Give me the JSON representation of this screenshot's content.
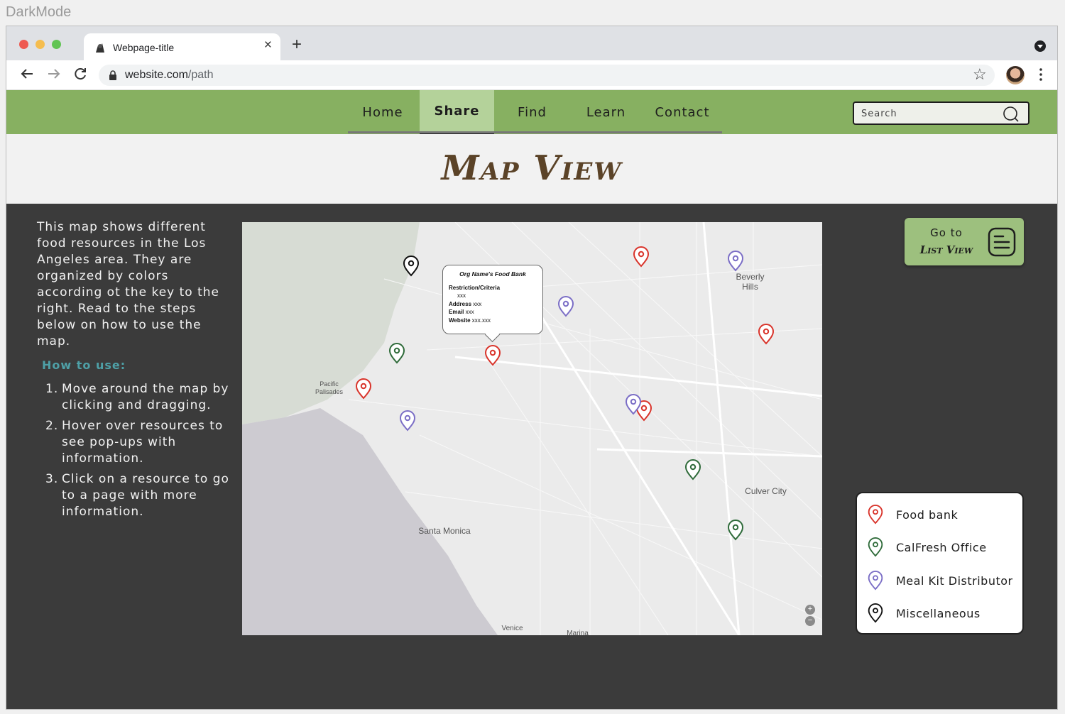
{
  "frame_label": "DarkMode",
  "browser": {
    "tab_title": "Webpage-title",
    "tab_close": "×",
    "new_tab": "+",
    "url_host": "website.com",
    "url_path": "/path",
    "traffic_colors": [
      "#ee5a52",
      "#f5bd4f",
      "#61c454"
    ]
  },
  "nav": {
    "items": [
      {
        "label": "Home"
      },
      {
        "label": "Share",
        "active": true
      },
      {
        "label": "Find"
      },
      {
        "label": "Learn"
      },
      {
        "label": "Contact"
      }
    ],
    "search_placeholder": "Search",
    "bar_color": "#87b061",
    "active_color": "#b4d29a"
  },
  "page_title": "Map View",
  "intro_text": "This map shows different food resources in the Los Angeles area. They are organized by colors according ot the key to the right. Read to the steps below on how to use the map.",
  "howto_title": "How to use:",
  "steps": [
    {
      "num": "1.",
      "text": "Move around the map by clicking and dragging."
    },
    {
      "num": "2.",
      "text": "Hover over resources to see pop-ups with information."
    },
    {
      "num": "3.",
      "text": "Click on a resource to go to a page with more information."
    }
  ],
  "map": {
    "labels": {
      "pacific_palisades": "Pacific\nPalisades",
      "beverly_hills": "Beverly\nHills",
      "culver_city": "Culver City",
      "santa_monica": "Santa Monica",
      "venice": "Venice",
      "marina": "Marina"
    },
    "popup": {
      "title": "Org Name's Food Bank",
      "restriction_label": "Restriction/Criteria",
      "restriction_value": "xxx",
      "address_label": "Address",
      "address_value": "xxx",
      "email_label": "Email",
      "email_value": "xxx",
      "website_label": "Website",
      "website_value": "xxx.xxx"
    },
    "zoom_in": "+",
    "zoom_out": "−",
    "pin_colors": {
      "food_bank": "#d9342b",
      "calfresh": "#2f6b3a",
      "meal_kit": "#7b6ec6",
      "misc": "#111111"
    }
  },
  "list_view_button": {
    "line1": "Go to",
    "line2": "List View"
  },
  "legend": {
    "items": [
      {
        "label": "Food bank",
        "color": "#d9342b"
      },
      {
        "label": "CalFresh Office",
        "color": "#2f6b3a"
      },
      {
        "label": "Meal Kit Distributor",
        "color": "#7b6ec6"
      },
      {
        "label": "Miscellaneous",
        "color": "#111111"
      }
    ]
  }
}
